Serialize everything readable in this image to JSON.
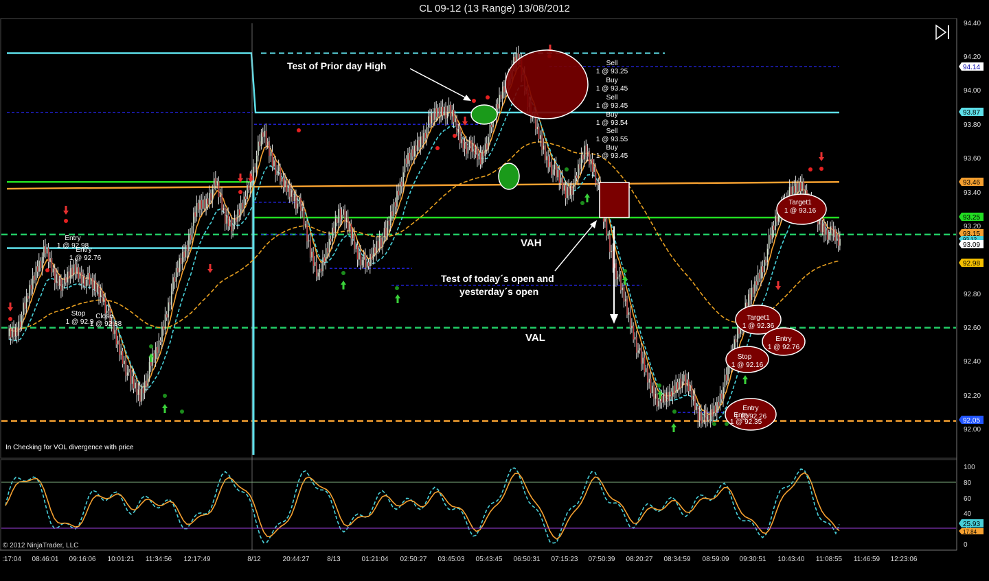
{
  "window": {
    "title": "CL 09-12 (13 Range)  13/08/2012"
  },
  "toolbar": {
    "toggle_icon": "play-to-end-icon"
  },
  "footer": {
    "copyright": "© 2012 NinjaTrader, LLC",
    "indicator_note": "In  Checking for VOL divergence with price"
  },
  "colors": {
    "up_candle": "#d8ecd0",
    "down_candle": "#c62828",
    "prior_high": "#5ee0ea",
    "green_level": "#22dd22",
    "orange_level": "#f5a030",
    "vah_val": "#22cc66",
    "vwap": "#e8a020",
    "ema": "#f5a030",
    "band": "#48cfd8",
    "stoch_k": "#48cfd8",
    "stoch_d": "#f5a030",
    "hours_line": "#2020cc"
  },
  "chart_data": [
    {
      "type": "candlestick",
      "title": "CL 09-12 (13 Range)  13/08/2012",
      "ylim": [
        91.86,
        94.44
      ],
      "y_ticks": [
        "94.40",
        "94.20",
        "94.00",
        "93.80",
        "93.60",
        "93.40",
        "93.20",
        "92.80",
        "92.60",
        "92.40",
        "92.20",
        "92.00"
      ],
      "x_ticks": [
        ":17:04",
        "08:46:01",
        "09:16:06",
        "10:01:21",
        "11:34:56",
        "12:17:49",
        "8/12",
        "20:44:27",
        "8/13",
        "01:21:04",
        "02:50:27",
        "03:45:03",
        "05:43:45",
        "06:50:31",
        "07:15:23",
        "07:50:39",
        "08:20:27",
        "08:34:59",
        "08:59:09",
        "09:30:51",
        "10:43:40",
        "11:08:55",
        "11:46:59",
        "12:23:06"
      ],
      "close_path": [
        92.55,
        92.6,
        92.75,
        92.95,
        93.05,
        92.9,
        92.85,
        92.95,
        92.9,
        92.85,
        92.8,
        92.6,
        92.45,
        92.28,
        92.2,
        92.35,
        92.5,
        92.75,
        92.95,
        93.1,
        93.3,
        93.35,
        93.45,
        93.25,
        93.2,
        93.35,
        93.55,
        93.75,
        93.6,
        93.45,
        93.4,
        93.3,
        93.05,
        92.9,
        93.1,
        93.3,
        93.2,
        93.05,
        92.95,
        93.1,
        93.15,
        93.35,
        93.55,
        93.65,
        93.75,
        93.85,
        93.9,
        93.85,
        93.7,
        93.65,
        93.6,
        93.75,
        93.95,
        94.1,
        94.2,
        93.95,
        93.75,
        93.6,
        93.5,
        93.4,
        93.45,
        93.65,
        93.55,
        93.25,
        93.0,
        92.8,
        92.6,
        92.4,
        92.25,
        92.15,
        92.2,
        92.3,
        92.25,
        92.1,
        92.05,
        92.15,
        92.3,
        92.55,
        92.7,
        92.85,
        93.0,
        93.2,
        93.35,
        93.4,
        93.45,
        93.3,
        93.2,
        93.15,
        93.1
      ],
      "levels": [
        {
          "label": "94.14",
          "value": 94.14,
          "badge_bg": "#ffffff",
          "badge_fg": "#0000aa"
        },
        {
          "label": "93.87",
          "value": 93.87,
          "badge_bg": "#5ee0ea",
          "badge_fg": "#000000"
        },
        {
          "label": "93.46",
          "value": 93.46,
          "badge_bg": "#f5a030",
          "badge_fg": "#000000"
        },
        {
          "label": "93.25",
          "value": 93.25,
          "badge_bg": "#22dd22",
          "badge_fg": "#000000"
        },
        {
          "label": "93.15",
          "value": 93.15,
          "badge_bg": "#f5a030",
          "badge_fg": "#000000"
        },
        {
          "label": "93.12",
          "value": 93.12,
          "badge_bg": "#48cfd8",
          "badge_fg": "#000000"
        },
        {
          "label": "93.09",
          "value": 93.09,
          "badge_bg": "#ffffff",
          "badge_fg": "#000000"
        },
        {
          "label": "92.98",
          "value": 92.98,
          "badge_bg": "#f5c000",
          "badge_fg": "#000000"
        },
        {
          "label": "92.05",
          "value": 92.05,
          "badge_bg": "#2255ff",
          "badge_fg": "#ffffff"
        }
      ],
      "annotations": {
        "prior_high": "Test of Prior day High",
        "open_line1": "Test of today´s open and",
        "open_line2": "yesterday´s open",
        "vah": "VAH",
        "val": "VAL"
      },
      "trade_labels": [
        "Sell",
        "1 @ 93.25",
        "Buy",
        "1 @ 93.45",
        "Sell",
        "1 @ 93.45",
        "Buy",
        "1 @ 93.54",
        "Sell",
        "1 @ 93.55",
        "Buy",
        "1 @ 93.45",
        "Entry",
        "1 @ 92.98",
        "Entry",
        "1 @ 92.76",
        "Stop",
        "1 @ 92.9",
        "Close",
        "1 @ 92.88",
        "Target1",
        "1 @ 93.16",
        "Target1",
        "1 @ 92.36",
        "Entry",
        "1 @ 92.76",
        "Stop",
        "1 @ 92.16",
        "Entry",
        "1 @ 92.26",
        "Entry",
        "1 @ 92.35"
      ]
    },
    {
      "type": "line",
      "title": "",
      "ylim": [
        0,
        100
      ],
      "y_ticks": [
        "100",
        "80",
        "60",
        "40",
        "20",
        "0"
      ],
      "series": [
        {
          "name": "",
          "color": "#48cfd8",
          "last": "25.93"
        },
        {
          "name": "",
          "color": "#f5a030",
          "last": "17.84"
        }
      ]
    }
  ]
}
